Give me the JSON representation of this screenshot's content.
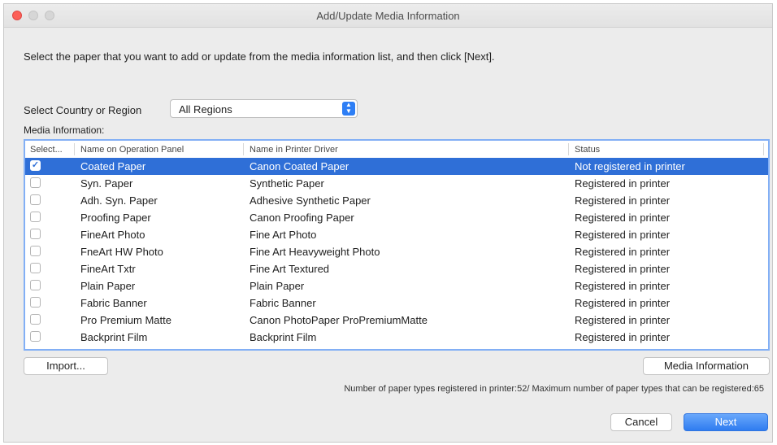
{
  "window": {
    "title": "Add/Update Media Information"
  },
  "instruction": "Select the paper that you want to add or update from the media information list, and then click [Next].",
  "region": {
    "label": "Select Country or Region",
    "value": "All Regions"
  },
  "media_label": "Media Information:",
  "table": {
    "columns": [
      "Select...",
      "Name on Operation Panel",
      "Name in Printer Driver",
      "Status"
    ],
    "rows": [
      {
        "checked": true,
        "panel": "Coated Paper",
        "driver": "Canon Coated Paper",
        "status": "Not registered in printer"
      },
      {
        "checked": false,
        "panel": "Syn. Paper",
        "driver": "Synthetic Paper",
        "status": "Registered in printer"
      },
      {
        "checked": false,
        "panel": "Adh. Syn. Paper",
        "driver": "Adhesive Synthetic Paper",
        "status": "Registered in printer"
      },
      {
        "checked": false,
        "panel": "Proofing Paper",
        "driver": "Canon Proofing Paper",
        "status": "Registered in printer"
      },
      {
        "checked": false,
        "panel": "FineArt Photo",
        "driver": "Fine Art Photo",
        "status": "Registered in printer"
      },
      {
        "checked": false,
        "panel": "FneArt HW Photo",
        "driver": "Fine Art Heavyweight Photo",
        "status": "Registered in printer"
      },
      {
        "checked": false,
        "panel": "FineArt Txtr",
        "driver": "Fine Art Textured",
        "status": "Registered in printer"
      },
      {
        "checked": false,
        "panel": "Plain Paper",
        "driver": "Plain Paper",
        "status": "Registered in printer"
      },
      {
        "checked": false,
        "panel": "Fabric Banner",
        "driver": "Fabric Banner",
        "status": "Registered in printer"
      },
      {
        "checked": false,
        "panel": "Pro Premium Matte",
        "driver": "Canon PhotoPaper ProPremiumMatte",
        "status": "Registered in printer"
      },
      {
        "checked": false,
        "panel": "Backprint Film",
        "driver": "Backprint Film",
        "status": "Registered in printer"
      }
    ]
  },
  "buttons": {
    "import": "Import...",
    "media_information": "Media Information",
    "cancel": "Cancel",
    "next": "Next"
  },
  "footer": "Number of paper types registered in printer:52/ Maximum number of paper types that can be registered:65",
  "colors": {
    "selection": "#2f6fd7",
    "accent": "#2d7ef5"
  }
}
